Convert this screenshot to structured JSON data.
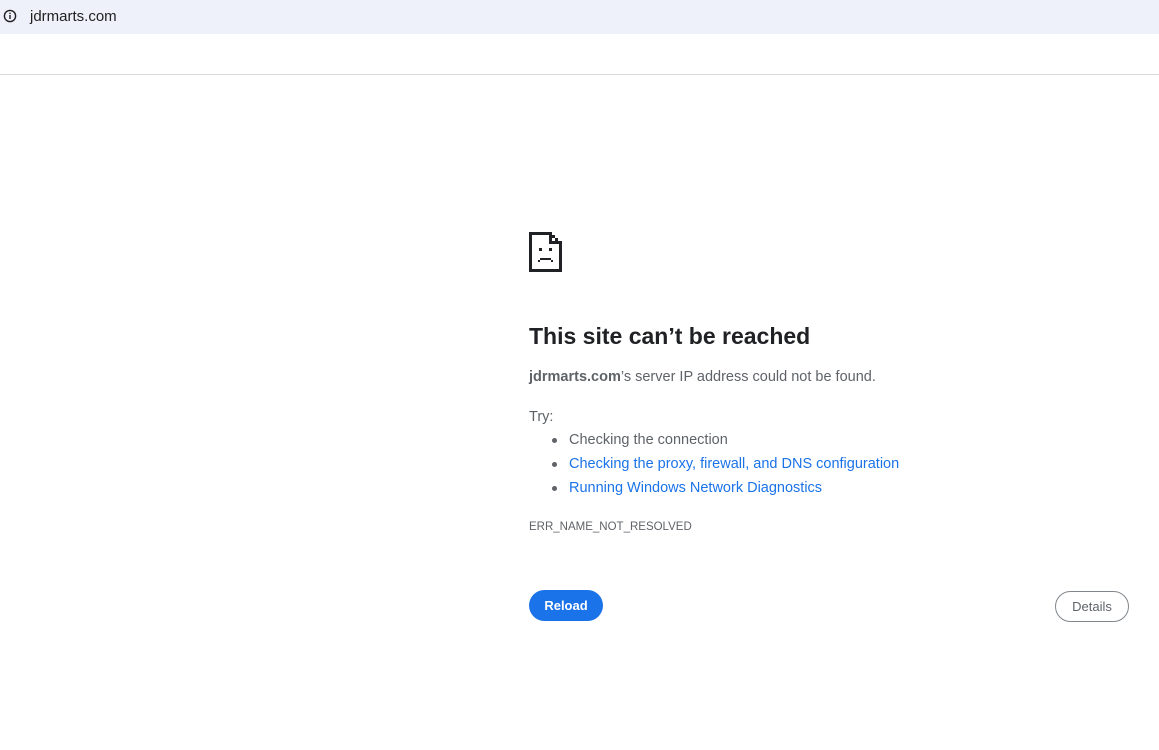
{
  "browser": {
    "url": "jdrmarts.com",
    "site_info_icon": "info-circle-icon"
  },
  "error": {
    "icon": "sad-page-icon",
    "title": "This site can’t be reached",
    "host": "jdrmarts.com",
    "description_suffix": "’s server IP address could not be found.",
    "try_label": "Try:",
    "suggestions": [
      {
        "text": "Checking the connection",
        "link": false
      },
      {
        "text": "Checking the proxy, firewall, and DNS configuration",
        "link": true
      },
      {
        "text": "Running Windows Network Diagnostics",
        "link": true
      }
    ],
    "code": "ERR_NAME_NOT_RESOLVED"
  },
  "buttons": {
    "reload_label": "Reload",
    "details_label": "Details"
  },
  "colors": {
    "accent": "#1a73e8",
    "omnibox_bg": "#eef1fa",
    "text_secondary": "#5f6368",
    "title": "#202124"
  }
}
